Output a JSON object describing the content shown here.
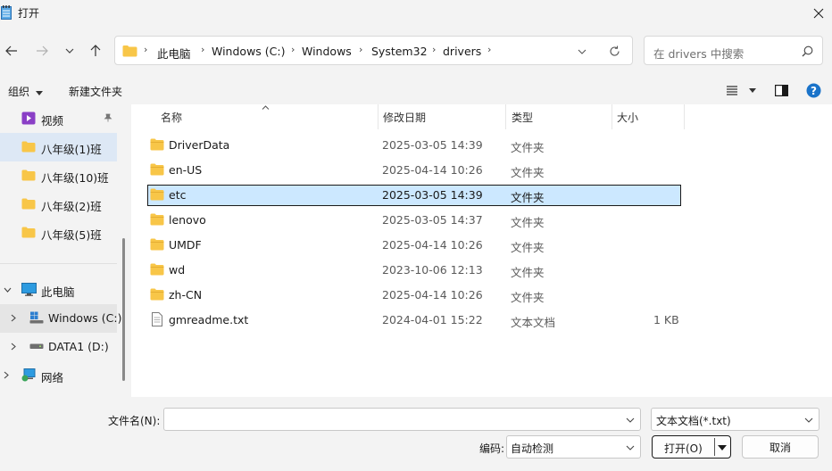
{
  "window": {
    "title": "打开"
  },
  "nav": {
    "breadcrumb": [
      "此电脑",
      "Windows (C:)",
      "Windows",
      "System32",
      "drivers"
    ],
    "search_placeholder": "在 drivers 中搜索"
  },
  "commands": {
    "organize": "组织",
    "new_folder": "新建文件夹"
  },
  "sidebar": {
    "quick": [
      "视频",
      "八年级(1)班",
      "八年级(10)班",
      "八年级(2)班",
      "八年级(5)班"
    ],
    "this_pc": "此电脑",
    "drives": [
      "Windows (C:)",
      "DATA1 (D:)"
    ],
    "network": "网络"
  },
  "columns": {
    "name": "名称",
    "modified": "修改日期",
    "type": "类型",
    "size": "大小"
  },
  "files": [
    {
      "name": "DriverData",
      "modified": "2025-03-05 14:39",
      "type": "文件夹",
      "size": ""
    },
    {
      "name": "en-US",
      "modified": "2025-04-14 10:26",
      "type": "文件夹",
      "size": ""
    },
    {
      "name": "etc",
      "modified": "2025-03-05 14:39",
      "type": "文件夹",
      "size": ""
    },
    {
      "name": "lenovo",
      "modified": "2025-03-05 14:37",
      "type": "文件夹",
      "size": ""
    },
    {
      "name": "UMDF",
      "modified": "2025-04-14 10:26",
      "type": "文件夹",
      "size": ""
    },
    {
      "name": "wd",
      "modified": "2023-10-06 12:13",
      "type": "文件夹",
      "size": ""
    },
    {
      "name": "zh-CN",
      "modified": "2025-04-14 10:26",
      "type": "文件夹",
      "size": ""
    },
    {
      "name": "gmreadme.txt",
      "modified": "2024-04-01 15:22",
      "type": "文本文档",
      "size": "1 KB"
    }
  ],
  "bottom": {
    "filename_label": "文件名(N):",
    "filename_value": "",
    "filetype_value": "文本文档(*.txt)",
    "encoding_label": "编码:",
    "encoding_value": "自动检测",
    "open_label": "打开(O)",
    "cancel_label": "取消"
  },
  "colors": {
    "accent": "#0067c0",
    "selection": "#cce8ff",
    "folder": "#f8c648"
  }
}
